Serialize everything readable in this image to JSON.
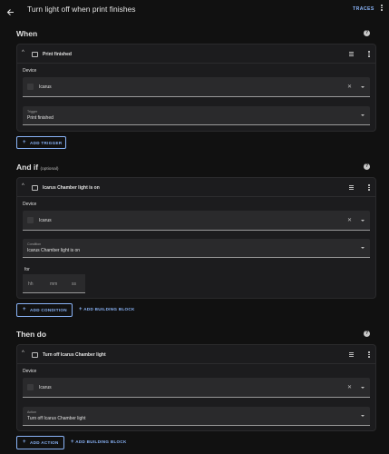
{
  "header": {
    "title": "Turn light off when print finishes",
    "traces_label": "TRACES",
    "back_icon": "arrow-left-icon",
    "menu_icon": "kebab-icon"
  },
  "colors": {
    "accent": "#8ab4f8",
    "background": "#111111",
    "card": "#1c1c1e",
    "field": "#2a2a2c"
  },
  "when": {
    "title": "When",
    "card": {
      "title": "Print finished",
      "device_label": "Device",
      "device_value": "Icarus",
      "trigger_small": "Trigger",
      "trigger_value": "Print finished"
    },
    "add_button": "ADD TRIGGER"
  },
  "and_if": {
    "title": "And if",
    "optional": "(optional)",
    "card": {
      "title": "Icarus Chamber light is on",
      "device_label": "Device",
      "device_value": "Icarus",
      "condition_small": "Condition",
      "condition_value": "Icarus Chamber light is on",
      "for_label": "for",
      "hh": "hh",
      "mm": "mm",
      "ss": "ss"
    },
    "add_button": "ADD CONDITION",
    "building_block_button": "ADD BUILDING BLOCK"
  },
  "then_do": {
    "title": "Then do",
    "card": {
      "title": "Turn off Icarus Chamber light",
      "device_label": "Device",
      "device_value": "Icarus",
      "action_small": "Action",
      "action_value": "Turn off Icarus Chamber light"
    },
    "add_button": "ADD ACTION",
    "building_block_button": "ADD BUILDING BLOCK"
  },
  "help_glyph": "?",
  "plus_glyph": "+",
  "clear_glyph": "✕",
  "collapse_glyph": "^"
}
